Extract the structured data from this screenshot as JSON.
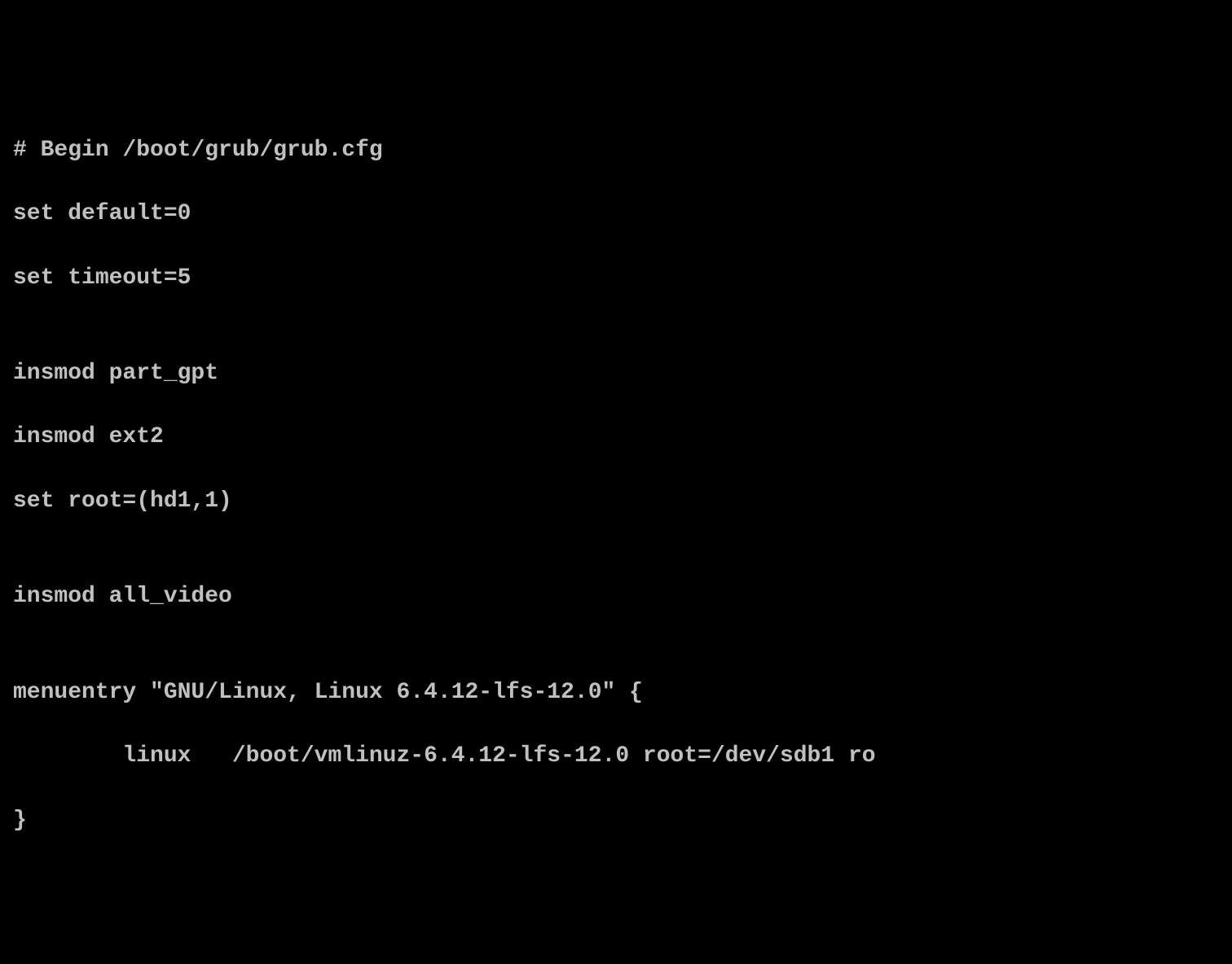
{
  "terminal": {
    "lines": [
      "# Begin /boot/grub/grub.cfg",
      "set default=0",
      "set timeout=5",
      "",
      "insmod part_gpt",
      "insmod ext2",
      "set root=(hd1,1)",
      "",
      "insmod all_video",
      "",
      "menuentry \"GNU/Linux, Linux 6.4.12-lfs-12.0\" {",
      "        linux   /boot/vmlinuz-6.4.12-lfs-12.0 root=/dev/sdb1 ro",
      "}"
    ]
  }
}
